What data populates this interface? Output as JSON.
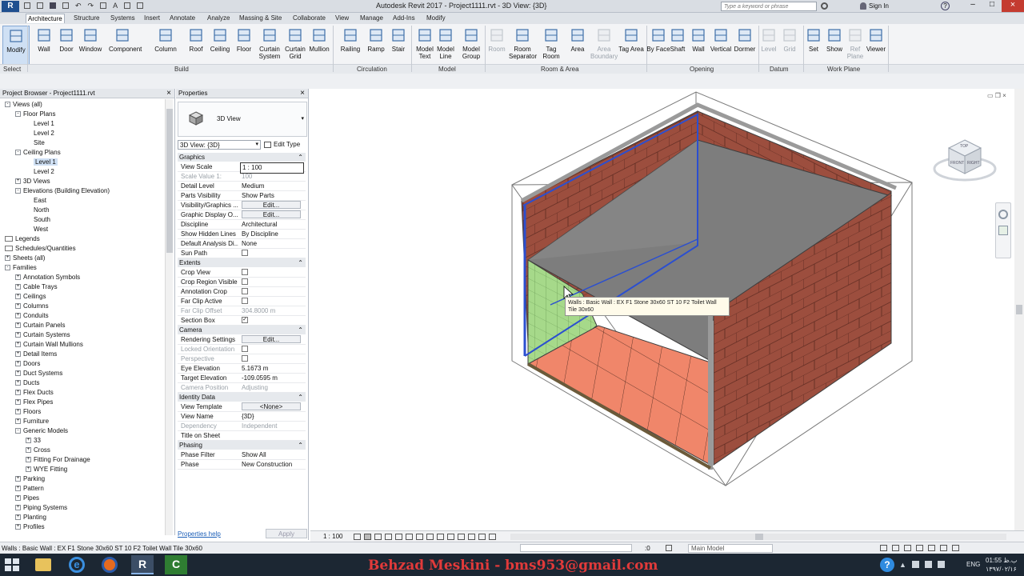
{
  "window": {
    "title": "Autodesk Revit 2017 -    Project1111.rvt - 3D View: {3D}",
    "search_placeholder": "Type a keyword or phrase",
    "sign_in": "Sign In"
  },
  "ribbon_tabs": [
    "Architecture",
    "Structure",
    "Systems",
    "Insert",
    "Annotate",
    "Analyze",
    "Massing & Site",
    "Collaborate",
    "View",
    "Manage",
    "Add-Ins",
    "Modify"
  ],
  "tools": [
    {
      "label": "Modify",
      "icon": "cursor-icon"
    },
    {
      "label": "Wall",
      "icon": "wall-icon"
    },
    {
      "label": "Door",
      "icon": "door-icon"
    },
    {
      "label": "Window",
      "icon": "window-icon"
    },
    {
      "label": "Component",
      "icon": "component-icon"
    },
    {
      "label": "Column",
      "icon": "column-icon"
    },
    {
      "label": "Roof",
      "icon": "roof-icon"
    },
    {
      "label": "Ceiling",
      "icon": "ceiling-icon"
    },
    {
      "label": "Floor",
      "icon": "floor-icon"
    },
    {
      "label": "Curtain System",
      "icon": "curtain-system-icon"
    },
    {
      "label": "Curtain Grid",
      "icon": "curtain-grid-icon"
    },
    {
      "label": "Mullion",
      "icon": "mullion-icon"
    },
    {
      "label": "Railing",
      "icon": "railing-icon"
    },
    {
      "label": "Ramp",
      "icon": "ramp-icon"
    },
    {
      "label": "Stair",
      "icon": "stair-icon"
    },
    {
      "label": "Model Text",
      "icon": "model-text-icon"
    },
    {
      "label": "Model Line",
      "icon": "model-line-icon"
    },
    {
      "label": "Model Group",
      "icon": "model-group-icon"
    },
    {
      "label": "Room",
      "icon": "room-icon"
    },
    {
      "label": "Room Separator",
      "icon": "room-separator-icon"
    },
    {
      "label": "Tag Room",
      "icon": "tag-room-icon"
    },
    {
      "label": "Area",
      "icon": "area-icon"
    },
    {
      "label": "Area Boundary",
      "icon": "area-boundary-icon"
    },
    {
      "label": "Tag Area",
      "icon": "tag-area-icon"
    },
    {
      "label": "By Face",
      "icon": "by-face-icon"
    },
    {
      "label": "Shaft",
      "icon": "shaft-icon"
    },
    {
      "label": "Wall",
      "icon": "wall-opening-icon"
    },
    {
      "label": "Vertical",
      "icon": "vertical-icon"
    },
    {
      "label": "Dormer",
      "icon": "dormer-icon"
    },
    {
      "label": "Level",
      "icon": "level-icon"
    },
    {
      "label": "Grid",
      "icon": "grid-icon"
    },
    {
      "label": "Set",
      "icon": "set-icon"
    },
    {
      "label": "Show",
      "icon": "show-icon"
    },
    {
      "label": "Ref Plane",
      "icon": "ref-plane-icon"
    },
    {
      "label": "Viewer",
      "icon": "viewer-icon"
    }
  ],
  "panels": [
    "Select",
    "Build",
    "Circulation",
    "Model",
    "Room & Area",
    "Opening",
    "Datum",
    "Work Plane"
  ],
  "project_browser": {
    "title": "Project Browser - Project1111.rvt",
    "items": [
      {
        "label": "Views (all)",
        "lvl": 0,
        "exp": "-"
      },
      {
        "label": "Floor Plans",
        "lvl": 1,
        "exp": "-"
      },
      {
        "label": "Level 1",
        "lvl": 2,
        "exp": ""
      },
      {
        "label": "Level 2",
        "lvl": 2,
        "exp": ""
      },
      {
        "label": "Site",
        "lvl": 2,
        "exp": ""
      },
      {
        "label": "Ceiling Plans",
        "lvl": 1,
        "exp": "-"
      },
      {
        "label": "Level 1",
        "lvl": 2,
        "exp": "",
        "sel": true
      },
      {
        "label": "Level 2",
        "lvl": 2,
        "exp": ""
      },
      {
        "label": "3D Views",
        "lvl": 1,
        "exp": "+"
      },
      {
        "label": "Elevations (Building Elevation)",
        "lvl": 1,
        "exp": "-"
      },
      {
        "label": "East",
        "lvl": 2,
        "exp": ""
      },
      {
        "label": "North",
        "lvl": 2,
        "exp": ""
      },
      {
        "label": "South",
        "lvl": 2,
        "exp": ""
      },
      {
        "label": "West",
        "lvl": 2,
        "exp": ""
      },
      {
        "label": "Legends",
        "lvl": 0,
        "exp": ""
      },
      {
        "label": "Schedules/Quantities",
        "lvl": 0,
        "exp": ""
      },
      {
        "label": "Sheets (all)",
        "lvl": 0,
        "exp": "+"
      },
      {
        "label": "Families",
        "lvl": 0,
        "exp": "-"
      },
      {
        "label": "Annotation Symbols",
        "lvl": 1,
        "exp": "+"
      },
      {
        "label": "Cable Trays",
        "lvl": 1,
        "exp": "+"
      },
      {
        "label": "Ceilings",
        "lvl": 1,
        "exp": "+"
      },
      {
        "label": "Columns",
        "lvl": 1,
        "exp": "+"
      },
      {
        "label": "Conduits",
        "lvl": 1,
        "exp": "+"
      },
      {
        "label": "Curtain Panels",
        "lvl": 1,
        "exp": "+"
      },
      {
        "label": "Curtain Systems",
        "lvl": 1,
        "exp": "+"
      },
      {
        "label": "Curtain Wall Mullions",
        "lvl": 1,
        "exp": "+"
      },
      {
        "label": "Detail Items",
        "lvl": 1,
        "exp": "+"
      },
      {
        "label": "Doors",
        "lvl": 1,
        "exp": "+"
      },
      {
        "label": "Duct Systems",
        "lvl": 1,
        "exp": "+"
      },
      {
        "label": "Ducts",
        "lvl": 1,
        "exp": "+"
      },
      {
        "label": "Flex Ducts",
        "lvl": 1,
        "exp": "+"
      },
      {
        "label": "Flex Pipes",
        "lvl": 1,
        "exp": "+"
      },
      {
        "label": "Floors",
        "lvl": 1,
        "exp": "+"
      },
      {
        "label": "Furniture",
        "lvl": 1,
        "exp": "+"
      },
      {
        "label": "Generic Models",
        "lvl": 1,
        "exp": "-"
      },
      {
        "label": "33",
        "lvl": 2,
        "exp": "+"
      },
      {
        "label": "Cross",
        "lvl": 2,
        "exp": "+"
      },
      {
        "label": "Fitting For Drainage",
        "lvl": 2,
        "exp": "+"
      },
      {
        "label": "WYE Fitting",
        "lvl": 2,
        "exp": "+"
      },
      {
        "label": "Parking",
        "lvl": 1,
        "exp": "+"
      },
      {
        "label": "Pattern",
        "lvl": 1,
        "exp": "+"
      },
      {
        "label": "Pipes",
        "lvl": 1,
        "exp": "+"
      },
      {
        "label": "Piping Systems",
        "lvl": 1,
        "exp": "+"
      },
      {
        "label": "Planting",
        "lvl": 1,
        "exp": "+"
      },
      {
        "label": "Profiles",
        "lvl": 1,
        "exp": "+"
      }
    ]
  },
  "properties": {
    "title": "Properties",
    "type_name": "3D View",
    "selector": "3D View: {3D}",
    "edit_type": "Edit Type",
    "help": "Properties help",
    "apply": "Apply",
    "rows": [
      {
        "cat": "Graphics"
      },
      {
        "k": "View Scale",
        "v": "1 : 100",
        "input": true
      },
      {
        "k": "Scale Value    1:",
        "v": "100",
        "dis": true
      },
      {
        "k": "Detail Level",
        "v": "Medium"
      },
      {
        "k": "Parts Visibility",
        "v": "Show Parts"
      },
      {
        "k": "Visibility/Graphics ...",
        "v": "Edit...",
        "btn": true
      },
      {
        "k": "Graphic Display O...",
        "v": "Edit...",
        "btn": true
      },
      {
        "k": "Discipline",
        "v": "Architectural"
      },
      {
        "k": "Show Hidden Lines",
        "v": "By Discipline"
      },
      {
        "k": "Default Analysis Di...",
        "v": "None"
      },
      {
        "k": "Sun Path",
        "v": "",
        "cb": false
      },
      {
        "cat": "Extents"
      },
      {
        "k": "Crop View",
        "v": "",
        "cb": false
      },
      {
        "k": "Crop Region Visible",
        "v": "",
        "cb": false
      },
      {
        "k": "Annotation Crop",
        "v": "",
        "cb": false
      },
      {
        "k": "Far Clip Active",
        "v": "",
        "cb": false
      },
      {
        "k": "Far Clip Offset",
        "v": "304.8000 m",
        "dis": true
      },
      {
        "k": "Section Box",
        "v": "",
        "cb": true
      },
      {
        "cat": "Camera"
      },
      {
        "k": "Rendering Settings",
        "v": "Edit...",
        "btn": true
      },
      {
        "k": "Locked Orientation",
        "v": "",
        "cb": false,
        "dis": true
      },
      {
        "k": "Perspective",
        "v": "",
        "cb": false,
        "dis": true
      },
      {
        "k": "Eye Elevation",
        "v": "5.1673 m"
      },
      {
        "k": "Target Elevation",
        "v": "-109.0595 m"
      },
      {
        "k": "Camera Position",
        "v": "Adjusting",
        "dis": true
      },
      {
        "cat": "Identity Data"
      },
      {
        "k": "View Template",
        "v": "<None>",
        "btn": true
      },
      {
        "k": "View Name",
        "v": "{3D}"
      },
      {
        "k": "Dependency",
        "v": "Independent",
        "dis": true
      },
      {
        "k": "Title on Sheet",
        "v": ""
      },
      {
        "cat": "Phasing"
      },
      {
        "k": "Phase Filter",
        "v": "Show All"
      },
      {
        "k": "Phase",
        "v": "New Construction"
      }
    ]
  },
  "view": {
    "tooltip": "Walls : Basic Wall : EX F1 Stone 30x60 ST 10 F2 Toilet Wall Tile 30x60",
    "scale": "1 : 100",
    "viewcube_top": "TOP",
    "viewcube_front": "FRONT",
    "viewcube_right": "RIGHT"
  },
  "status": {
    "text": "Walls : Basic Wall : EX F1 Stone 30x60 ST 10 F2 Toilet Wall Tile 30x60",
    "count": ":0",
    "model": "Main Model"
  },
  "taskbar": {
    "credit": "Behzad Meskini - bms953@gmail.com",
    "lang": "ENG",
    "time": "01:55 ب.ظ",
    "date": "۱۳۹۷/۰۲/۱۶"
  },
  "colors": {
    "accent": "#2b6cc4",
    "brick": "#9c4e3e",
    "floor": "#f0866a",
    "green": "#a6d98a",
    "ceiling": "#7d7d7d"
  }
}
